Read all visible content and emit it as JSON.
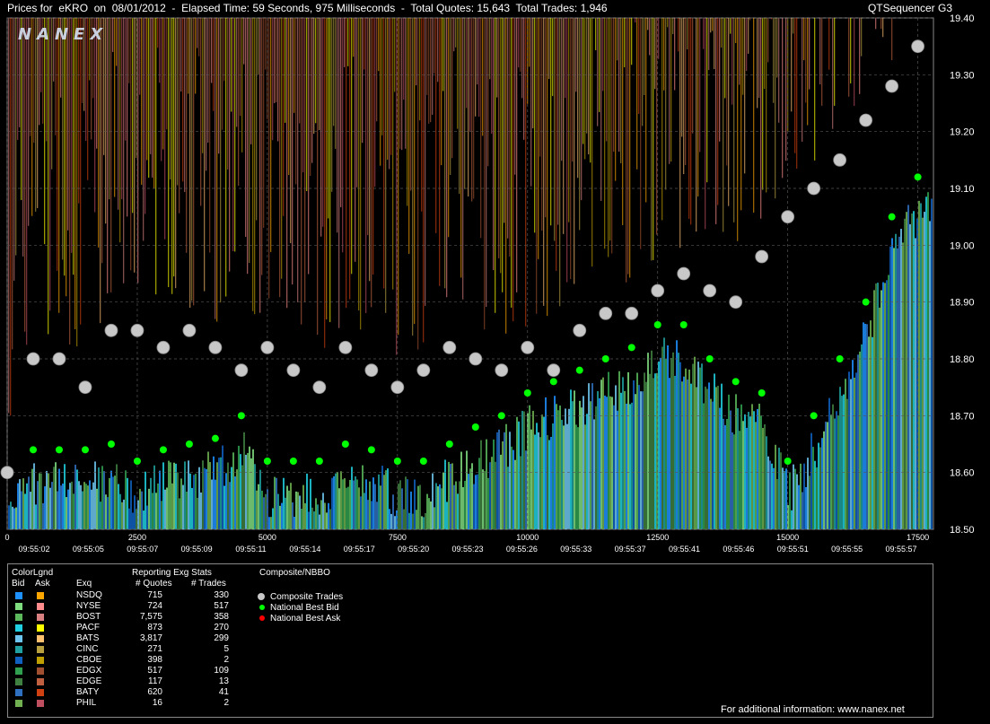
{
  "header": {
    "title": "Prices for  eKRO  on  08/01/2012  -  Elapsed Time: 59 Seconds, 975 Milliseconds  -  Total Quotes: 15,643  Total Trades: 1,946",
    "app": "QTSequencer G3"
  },
  "chart_data": {
    "type": "scatter",
    "watermark": "NANEX",
    "y_ticks": [
      "19.40",
      "19.30",
      "19.20",
      "19.10",
      "19.00",
      "18.90",
      "18.80",
      "18.70",
      "18.60",
      "18.50"
    ],
    "ylim": [
      18.5,
      19.4
    ],
    "x_ticks": [
      "0",
      "2500",
      "5000",
      "7500",
      "10000",
      "12500",
      "15000",
      "17500"
    ],
    "xlim": [
      0,
      17800
    ],
    "time_labels": [
      "09:55:02",
      "09:55:05",
      "09:55:07",
      "09:55:09",
      "09:55:11",
      "09:55:14",
      "09:55:17",
      "09:55:20",
      "09:55:23",
      "09:55:26",
      "09:55:33",
      "09:55:37",
      "09:55:41",
      "09:55:46",
      "09:55:51",
      "09:55:55",
      "09:55:57"
    ],
    "series": [
      {
        "name": "Composite Trades",
        "color": "#c8c8c8"
      },
      {
        "name": "National Best Bid",
        "color": "#00ff00"
      },
      {
        "name": "National Best Ask",
        "color": "#ff0000"
      }
    ],
    "trades": [
      [
        0,
        18.6
      ],
      [
        500,
        18.8
      ],
      [
        1000,
        18.8
      ],
      [
        1500,
        18.75
      ],
      [
        2000,
        18.85
      ],
      [
        2500,
        18.85
      ],
      [
        3000,
        18.82
      ],
      [
        3500,
        18.85
      ],
      [
        4000,
        18.82
      ],
      [
        4500,
        18.78
      ],
      [
        5000,
        18.82
      ],
      [
        5500,
        18.78
      ],
      [
        6000,
        18.75
      ],
      [
        6500,
        18.82
      ],
      [
        7000,
        18.78
      ],
      [
        7500,
        18.75
      ],
      [
        8000,
        18.78
      ],
      [
        8500,
        18.82
      ],
      [
        9000,
        18.8
      ],
      [
        9500,
        18.78
      ],
      [
        10000,
        18.82
      ],
      [
        10500,
        18.78
      ],
      [
        11000,
        18.85
      ],
      [
        11500,
        18.88
      ],
      [
        12000,
        18.88
      ],
      [
        12500,
        18.92
      ],
      [
        13000,
        18.95
      ],
      [
        13500,
        18.92
      ],
      [
        14000,
        18.9
      ],
      [
        14500,
        18.98
      ],
      [
        15000,
        19.05
      ],
      [
        15500,
        19.1
      ],
      [
        16000,
        19.15
      ],
      [
        16500,
        19.22
      ],
      [
        17000,
        19.28
      ],
      [
        17500,
        19.35
      ]
    ],
    "best_bid": [
      [
        0,
        18.6
      ],
      [
        500,
        18.64
      ],
      [
        1000,
        18.64
      ],
      [
        1500,
        18.64
      ],
      [
        2000,
        18.65
      ],
      [
        2500,
        18.62
      ],
      [
        3000,
        18.64
      ],
      [
        3500,
        18.65
      ],
      [
        4000,
        18.66
      ],
      [
        4500,
        18.7
      ],
      [
        5000,
        18.62
      ],
      [
        5500,
        18.62
      ],
      [
        6000,
        18.62
      ],
      [
        6500,
        18.65
      ],
      [
        7000,
        18.64
      ],
      [
        7500,
        18.62
      ],
      [
        8000,
        18.62
      ],
      [
        8500,
        18.65
      ],
      [
        9000,
        18.68
      ],
      [
        9500,
        18.7
      ],
      [
        10000,
        18.74
      ],
      [
        10500,
        18.76
      ],
      [
        11000,
        18.78
      ],
      [
        11500,
        18.8
      ],
      [
        12000,
        18.82
      ],
      [
        12500,
        18.86
      ],
      [
        13000,
        18.86
      ],
      [
        13500,
        18.8
      ],
      [
        14000,
        18.76
      ],
      [
        14500,
        18.74
      ],
      [
        15000,
        18.62
      ],
      [
        15500,
        18.7
      ],
      [
        16000,
        18.8
      ],
      [
        16500,
        18.9
      ],
      [
        17000,
        19.05
      ],
      [
        17500,
        19.12
      ]
    ]
  },
  "legend": {
    "colorlgnd": "ColorLgnd",
    "bid": "Bid",
    "ask": "Ask",
    "exq": "Exq",
    "stats_title": "Reporting Exg Stats",
    "quotes_hdr": "# Quotes",
    "trades_hdr": "# Trades",
    "composite_title": "Composite/NBBO",
    "footer": "For additional information: www.nanex.net",
    "rows": [
      {
        "exch": "NSDQ",
        "quotes": "715",
        "trades": "330",
        "bid": "#1e90ff",
        "ask": "#ffa500"
      },
      {
        "exch": "NYSE",
        "quotes": "724",
        "trades": "517",
        "bid": "#7fdc7f",
        "ask": "#ff8c8c"
      },
      {
        "exch": "BOST",
        "quotes": "7,575",
        "trades": "358",
        "bid": "#5cb85c",
        "ask": "#d98080"
      },
      {
        "exch": "PACF",
        "quotes": "873",
        "trades": "270",
        "bid": "#20d0e0",
        "ask": "#ffff00"
      },
      {
        "exch": "BATS",
        "quotes": "3,817",
        "trades": "299",
        "bid": "#6ec6f0",
        "ask": "#ffc070"
      },
      {
        "exch": "CINC",
        "quotes": "271",
        "trades": "5",
        "bid": "#20a0a0",
        "ask": "#b8a040"
      },
      {
        "exch": "CBOE",
        "quotes": "398",
        "trades": "2",
        "bid": "#1060c0",
        "ask": "#c0a000"
      },
      {
        "exch": "EDGX",
        "quotes": "517",
        "trades": "109",
        "bid": "#30a050",
        "ask": "#a05030"
      },
      {
        "exch": "EDGE",
        "quotes": "117",
        "trades": "13",
        "bid": "#408040",
        "ask": "#c06040"
      },
      {
        "exch": "BATY",
        "quotes": "620",
        "trades": "41",
        "bid": "#3070c0",
        "ask": "#d04010"
      },
      {
        "exch": "PHIL",
        "quotes": "16",
        "trades": "2",
        "bid": "#70b050",
        "ask": "#c05060"
      }
    ]
  }
}
